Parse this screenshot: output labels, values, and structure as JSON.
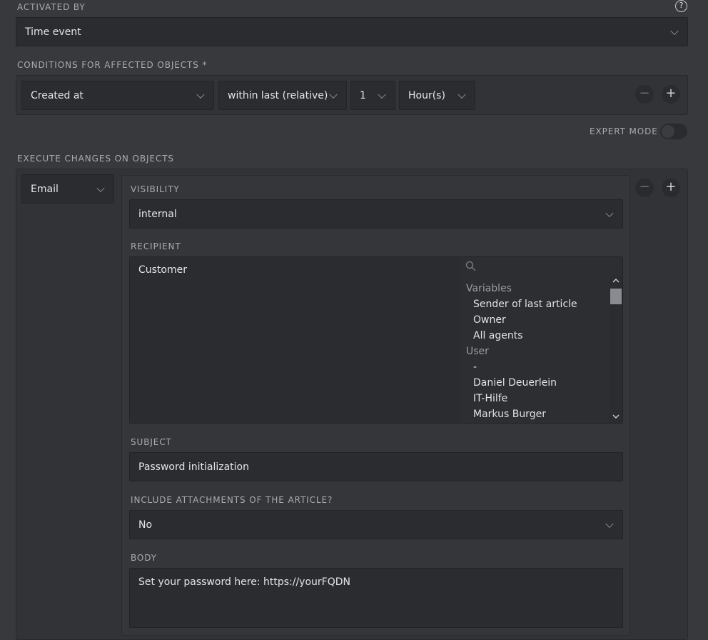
{
  "activated_by": {
    "label": "ACTIVATED BY",
    "help": "?",
    "value": "Time event"
  },
  "conditions": {
    "label": "CONDITIONS FOR AFFECTED OBJECTS *",
    "attribute": "Created at",
    "operator": "within last (relative)",
    "amount": "1",
    "unit": "Hour(s)",
    "remove_symbol": "−",
    "add_symbol": "+"
  },
  "expert_mode": {
    "label": "EXPERT MODE",
    "enabled": false
  },
  "execute": {
    "label": "EXECUTE CHANGES ON OBJECTS",
    "action": "Email",
    "remove_symbol": "−",
    "add_symbol": "+",
    "visibility": {
      "label": "VISIBILITY",
      "value": "internal"
    },
    "recipient": {
      "label": "RECIPIENT",
      "selected": "Customer",
      "groups": [
        {
          "name": "Variables",
          "items": [
            "Sender of last article",
            "Owner",
            "All agents"
          ]
        },
        {
          "name": "User",
          "items": [
            "-",
            "Daniel Deuerlein",
            "IT-Hilfe",
            "Markus Burger"
          ]
        }
      ]
    },
    "subject": {
      "label": "SUBJECT",
      "value": "Password initialization"
    },
    "attachments": {
      "label": "INCLUDE ATTACHMENTS OF THE ARTICLE?",
      "value": "No"
    },
    "body": {
      "label": "BODY",
      "value": "Set your password here: https://yourFQDN"
    }
  },
  "icons": [
    "help-icon",
    "chevron-down-icon",
    "minus-icon",
    "plus-icon",
    "search-icon",
    "scroll-up-icon",
    "scroll-down-icon"
  ],
  "colors": {
    "background": "#38393d",
    "field": "#2b2c30",
    "panel": "#323337",
    "label": "#a9abb0"
  }
}
